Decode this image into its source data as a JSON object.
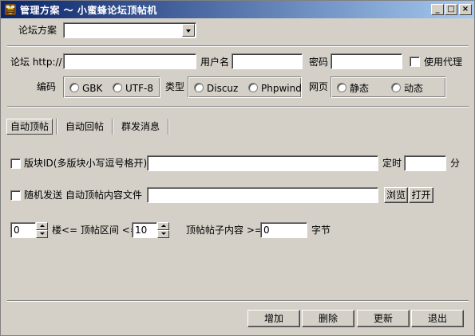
{
  "window": {
    "title": "管理方案 ～ 小蜜蜂论坛顶帖机",
    "controls": {
      "minimize": "_",
      "maximize": "□",
      "close": "×"
    }
  },
  "scheme": {
    "label": "论坛方案",
    "value": ""
  },
  "forum": {
    "url_label": "论坛 http://",
    "url_value": "",
    "username_label": "用户名",
    "username_value": "",
    "password_label": "密码",
    "password_value": "",
    "proxy_label": "使用代理",
    "proxy_checked": false
  },
  "encoding": {
    "label": "编码",
    "options": [
      "GBK",
      "UTF-8"
    ]
  },
  "type": {
    "label": "类型",
    "options": [
      "Discuz",
      "Phpwind"
    ]
  },
  "webpage": {
    "label": "网页",
    "options": [
      "静态",
      "动态"
    ]
  },
  "tabs": [
    {
      "label": "自动顶帖",
      "active": true
    },
    {
      "label": "自动回帖",
      "active": false
    },
    {
      "label": "群发消息",
      "active": false
    }
  ],
  "board": {
    "label": "版块ID(多版块小写逗号格开)",
    "value": "",
    "timer_label": "定时",
    "timer_value": "",
    "unit": "分"
  },
  "random": {
    "label": "随机发送",
    "file_label": "自动顶帖内容文件",
    "file_value": "",
    "browse": "浏览",
    "open": "打开"
  },
  "range": {
    "min_value": "0",
    "mid_label": "楼<= 顶帖区间 <=",
    "max_value": "10",
    "content_label": "顶帖帖子内容 >=",
    "content_value": "0",
    "unit": "字节"
  },
  "buttons": {
    "add": "增加",
    "delete": "删除",
    "update": "更新",
    "exit": "退出"
  }
}
